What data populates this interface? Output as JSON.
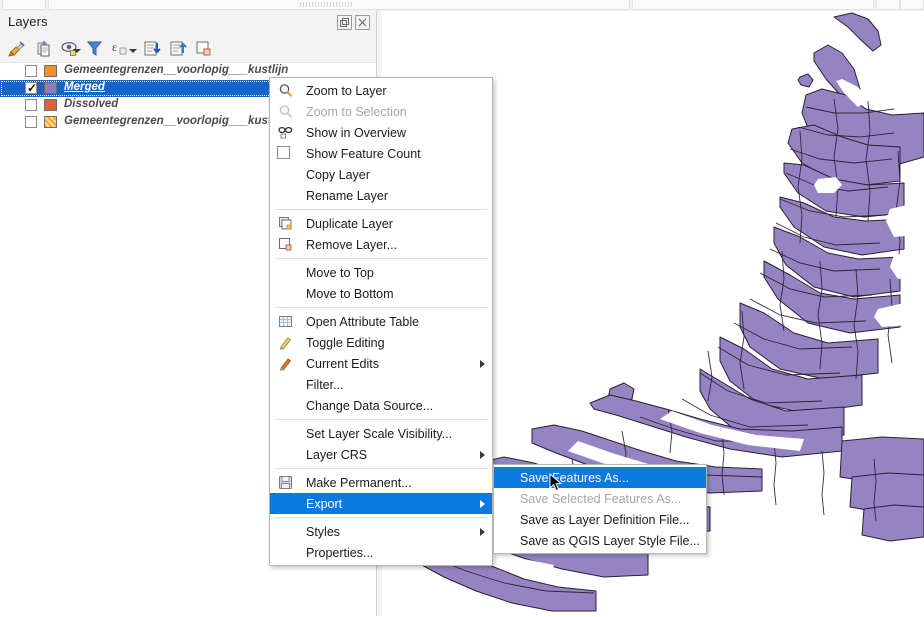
{
  "app": {
    "panel_title": "Layers",
    "panel_buttons": [
      {
        "name": "undock-panel-button",
        "glyph": "⧉"
      },
      {
        "name": "close-panel-button",
        "glyph": "✕"
      }
    ]
  },
  "panel_toolbar": {
    "items": [
      {
        "name": "open-layer-styling-panel-icon",
        "tooltip": "Open the Layer Styling panel"
      },
      {
        "name": "add-group-icon",
        "tooltip": "Add Group"
      },
      {
        "name": "manage-map-themes-icon",
        "tooltip": "Manage Map Themes"
      },
      {
        "name": "filter-legend-icon",
        "tooltip": "Filter Legend"
      },
      {
        "name": "filter-legend-by-expression-icon",
        "tooltip": "Filter Legend by Expression"
      },
      {
        "name": "expand-all-icon",
        "tooltip": "Expand All"
      },
      {
        "name": "collapse-all-icon",
        "tooltip": "Collapse All"
      },
      {
        "name": "remove-layer-group-icon",
        "tooltip": "Remove Layer/Group"
      }
    ]
  },
  "layers": [
    {
      "name": "Gemeentegrenzen__voorlopig___kustlijn",
      "checked": false,
      "selected": false,
      "symbol_color": "#f29220",
      "symbol_style": "solid"
    },
    {
      "name": "Merged",
      "checked": true,
      "selected": true,
      "symbol_color": "#8b7fc0",
      "symbol_style": "solid"
    },
    {
      "name": "Dissolved",
      "checked": false,
      "selected": false,
      "symbol_color": "#d9633b",
      "symbol_style": "solid"
    },
    {
      "name": "Gemeentegrenzen__voorlopig___kust",
      "checked": false,
      "selected": false,
      "symbol_color": "#f5a623",
      "symbol_style": "hatch"
    }
  ],
  "context_menu": {
    "items": [
      {
        "label": "Zoom to Layer",
        "accel": "Z",
        "icon": "zoom-to-layer-icon",
        "disabled": false,
        "submenu": false,
        "checkbox": false
      },
      {
        "label": "Zoom to Selection",
        "accel": "Z",
        "icon": "zoom-to-selection-icon",
        "disabled": true,
        "submenu": false,
        "checkbox": false
      },
      {
        "label": "Show in Overview",
        "accel": "S",
        "icon": "show-in-overview-icon",
        "disabled": false,
        "submenu": false,
        "checkbox": false
      },
      {
        "label": "Show Feature Count",
        "accel": "",
        "icon": "",
        "disabled": false,
        "submenu": false,
        "checkbox": true
      },
      {
        "label": "Copy Layer",
        "accel": "",
        "icon": "",
        "disabled": false,
        "submenu": false,
        "checkbox": false
      },
      {
        "label": "Rename Layer",
        "accel": "n",
        "icon": "",
        "disabled": false,
        "submenu": false,
        "checkbox": false
      },
      {
        "separator": true
      },
      {
        "label": "Duplicate Layer",
        "accel": "D",
        "icon": "duplicate-layer-icon",
        "disabled": false,
        "submenu": false,
        "checkbox": false
      },
      {
        "label": "Remove Layer...",
        "accel": "R",
        "icon": "remove-layer-icon",
        "disabled": false,
        "submenu": false,
        "checkbox": false
      },
      {
        "separator": true
      },
      {
        "label": "Move to Top",
        "accel": "T",
        "icon": "",
        "disabled": false,
        "submenu": false,
        "checkbox": false
      },
      {
        "label": "Move to Bottom",
        "accel": "B",
        "icon": "",
        "disabled": false,
        "submenu": false,
        "checkbox": false
      },
      {
        "separator": true
      },
      {
        "label": "Open Attribute Table",
        "accel": "O",
        "icon": "attribute-table-icon",
        "disabled": false,
        "submenu": false,
        "checkbox": false
      },
      {
        "label": "Toggle Editing",
        "accel": "",
        "icon": "toggle-editing-pencil-icon",
        "disabled": false,
        "submenu": false,
        "checkbox": false
      },
      {
        "label": "Current Edits",
        "accel": "",
        "icon": "current-edits-icon",
        "disabled": false,
        "submenu": true,
        "checkbox": false
      },
      {
        "label": "Filter...",
        "accel": "F",
        "icon": "",
        "disabled": false,
        "submenu": false,
        "checkbox": false
      },
      {
        "label": "Change Data Source...",
        "accel": "",
        "icon": "",
        "disabled": false,
        "submenu": false,
        "checkbox": false
      },
      {
        "separator": true
      },
      {
        "label": "Set Layer Scale Visibility...",
        "accel": "S",
        "icon": "",
        "disabled": false,
        "submenu": false,
        "checkbox": false
      },
      {
        "label": "Layer CRS",
        "accel": "",
        "icon": "",
        "disabled": false,
        "submenu": true,
        "checkbox": false
      },
      {
        "separator": true
      },
      {
        "label": "Make Permanent...",
        "accel": "",
        "icon": "make-permanent-save-icon",
        "disabled": false,
        "submenu": false,
        "checkbox": false
      },
      {
        "label": "Export",
        "accel": "",
        "icon": "",
        "disabled": false,
        "submenu": true,
        "checkbox": false,
        "highlighted": true
      },
      {
        "separator": true
      },
      {
        "label": "Styles",
        "accel": "",
        "icon": "",
        "disabled": false,
        "submenu": true,
        "checkbox": false
      },
      {
        "label": "Properties...",
        "accel": "P",
        "icon": "",
        "disabled": false,
        "submenu": false,
        "checkbox": false
      }
    ]
  },
  "export_submenu": {
    "items": [
      {
        "label": "Save Features As...",
        "disabled": false,
        "highlighted": true
      },
      {
        "label": "Save Selected Features As...",
        "disabled": true,
        "highlighted": false
      },
      {
        "label": "Save as Layer Definition File...",
        "disabled": false,
        "highlighted": false
      },
      {
        "label": "Save as QGIS Layer Style File...",
        "disabled": false,
        "highlighted": false
      }
    ]
  },
  "map": {
    "layer_fill": "#9584c4",
    "layer_stroke": "#2b2030",
    "background": "#ffffff",
    "description": "Municipality polygons of the western Netherlands (Merged layer)"
  },
  "colors": {
    "selection_blue": "#1565c8",
    "menu_highlight_blue": "#0a7ae0",
    "panel_bg": "#f3f3f3"
  }
}
